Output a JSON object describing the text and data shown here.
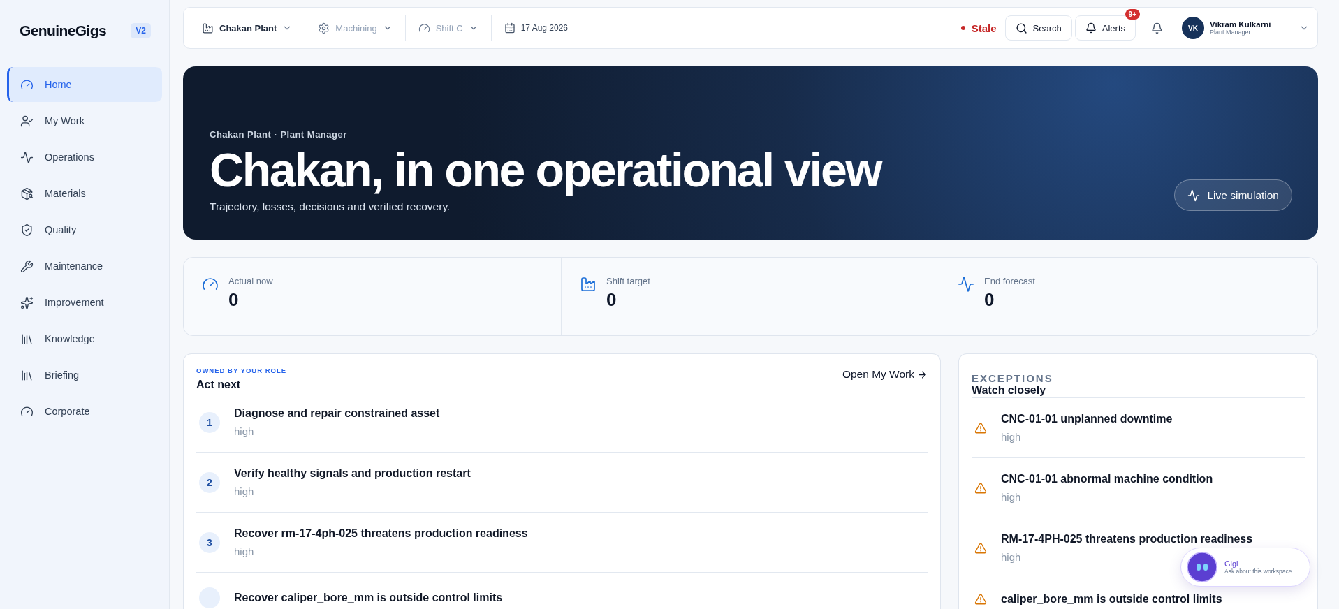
{
  "sidebar": {
    "logo": "GenuineGigs",
    "version": "V2",
    "items": [
      {
        "label": "Home",
        "selected": true
      },
      {
        "label": "My Work",
        "selected": false
      },
      {
        "label": "Operations",
        "selected": false
      },
      {
        "label": "Materials",
        "selected": false
      },
      {
        "label": "Quality",
        "selected": false
      },
      {
        "label": "Maintenance",
        "selected": false
      },
      {
        "label": "Improvement",
        "selected": false
      },
      {
        "label": "Knowledge",
        "selected": false
      },
      {
        "label": "Briefing",
        "selected": false
      },
      {
        "label": "Corporate",
        "selected": false
      }
    ]
  },
  "topbar": {
    "filters": [
      {
        "label": "Chakan Plant",
        "kind": "dropdown",
        "disabled": false
      },
      {
        "label": "Machining",
        "kind": "dropdown",
        "disabled": true
      },
      {
        "label": "Shift C",
        "kind": "dropdown",
        "disabled": true
      },
      {
        "label": "17 Aug 2026",
        "kind": "date",
        "disabled": false
      }
    ],
    "status": "Stale",
    "search": "Search",
    "alerts": {
      "label": "Alerts",
      "badge": "9+"
    },
    "user": {
      "initials": "VK",
      "name": "Vikram Kulkarni",
      "role": "Plant Manager"
    }
  },
  "hero": {
    "eyebrow": "Chakan Plant · Plant Manager",
    "title": "Chakan, in one operational view",
    "subtitle": "Trajectory, losses, decisions and verified recovery.",
    "button": "Live simulation"
  },
  "stats": [
    {
      "label": "Actual now",
      "value": "0"
    },
    {
      "label": "Shift target",
      "value": "0"
    },
    {
      "label": "End forecast",
      "value": "0"
    }
  ],
  "act_next": {
    "eyebrow": "OWNED BY YOUR ROLE",
    "title": "Act next",
    "link": "Open My Work",
    "items": [
      {
        "number": "1",
        "title": "Diagnose and repair constrained asset",
        "priority": "high"
      },
      {
        "number": "2",
        "title": "Verify healthy signals and production restart",
        "priority": "high"
      },
      {
        "number": "3",
        "title": "Recover rm-17-4ph-025 threatens production readiness",
        "priority": "high"
      },
      {
        "title": "Recover caliper_bore_mm is outside control limits"
      }
    ]
  },
  "exceptions": {
    "eyebrow": "EXCEPTIONS",
    "title": "Watch closely",
    "items": [
      {
        "title": "CNC-01-01 unplanned downtime",
        "priority": "high"
      },
      {
        "title": "CNC-01-01 abnormal machine condition",
        "priority": "high"
      },
      {
        "title": "RM-17-4PH-025 threatens production readiness",
        "priority": "high"
      },
      {
        "title": "caliper_bore_mm is outside control limits"
      }
    ]
  },
  "assistant": {
    "name": "Gigi",
    "hint": "Ask about this workspace"
  }
}
